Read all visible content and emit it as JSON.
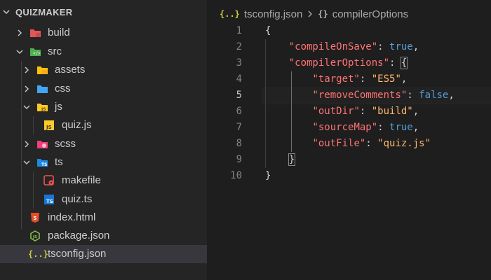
{
  "explorer": {
    "title": "QUIZMAKER",
    "items": [
      {
        "label": "build",
        "icon": "build-folder-icon",
        "type": "folder",
        "expanded": false
      },
      {
        "label": "src",
        "icon": "src-folder-icon",
        "type": "folder",
        "expanded": true
      },
      {
        "label": "assets",
        "icon": "assets-folder-icon",
        "type": "folder",
        "expanded": false
      },
      {
        "label": "css",
        "icon": "css-folder-icon",
        "type": "folder",
        "expanded": false
      },
      {
        "label": "js",
        "icon": "js-folder-icon",
        "type": "folder",
        "expanded": true
      },
      {
        "label": "quiz.js",
        "icon": "javascript-file-icon",
        "type": "file"
      },
      {
        "label": "scss",
        "icon": "scss-folder-icon",
        "type": "folder",
        "expanded": false
      },
      {
        "label": "ts",
        "icon": "ts-folder-icon",
        "type": "folder",
        "expanded": true
      },
      {
        "label": "makefile",
        "icon": "makefile-icon",
        "type": "file"
      },
      {
        "label": "quiz.ts",
        "icon": "typescript-file-icon",
        "type": "file"
      },
      {
        "label": "index.html",
        "icon": "html5-file-icon",
        "type": "file"
      },
      {
        "label": "package.json",
        "icon": "nodejs-file-icon",
        "type": "file"
      },
      {
        "label": "tsconfig.json",
        "icon": "json-file-icon",
        "type": "file",
        "selected": true
      }
    ]
  },
  "breadcrumb": {
    "file_icon": "{..}",
    "file": "tsconfig.json",
    "symbol_icon": "{}",
    "symbol": "compilerOptions"
  },
  "editor": {
    "active_line": 5,
    "line_numbers": [
      "1",
      "2",
      "3",
      "4",
      "5",
      "6",
      "7",
      "8",
      "9",
      "10"
    ],
    "lines": {
      "l1": {
        "open": "{"
      },
      "l2": {
        "key": "\"compileOnSave\"",
        "colon": ": ",
        "value": "true",
        "comma": ","
      },
      "l3": {
        "key": "\"compilerOptions\"",
        "colon": ": ",
        "brace": "{"
      },
      "l4": {
        "key": "\"target\"",
        "colon": ": ",
        "value": "\"ES5\"",
        "comma": ","
      },
      "l5": {
        "key": "\"removeComments\"",
        "colon": ": ",
        "value": "false",
        "comma": ","
      },
      "l6": {
        "key": "\"outDir\"",
        "colon": ": ",
        "value": "\"build\"",
        "comma": ","
      },
      "l7": {
        "key": "\"sourceMap\"",
        "colon": ": ",
        "value": "true",
        "comma": ","
      },
      "l8": {
        "key": "\"outFile\"",
        "colon": ": ",
        "value": "\"quiz.js\""
      },
      "l9": {
        "brace": "}"
      },
      "l10": {
        "close": "}"
      }
    }
  },
  "colors": {
    "sidebar_bg": "#252526",
    "editor_bg": "#1e1e1e",
    "selected_row": "#37373d",
    "json_key": "#ff7373",
    "json_string": "#ffb86c",
    "json_keyword": "#569cd6"
  }
}
